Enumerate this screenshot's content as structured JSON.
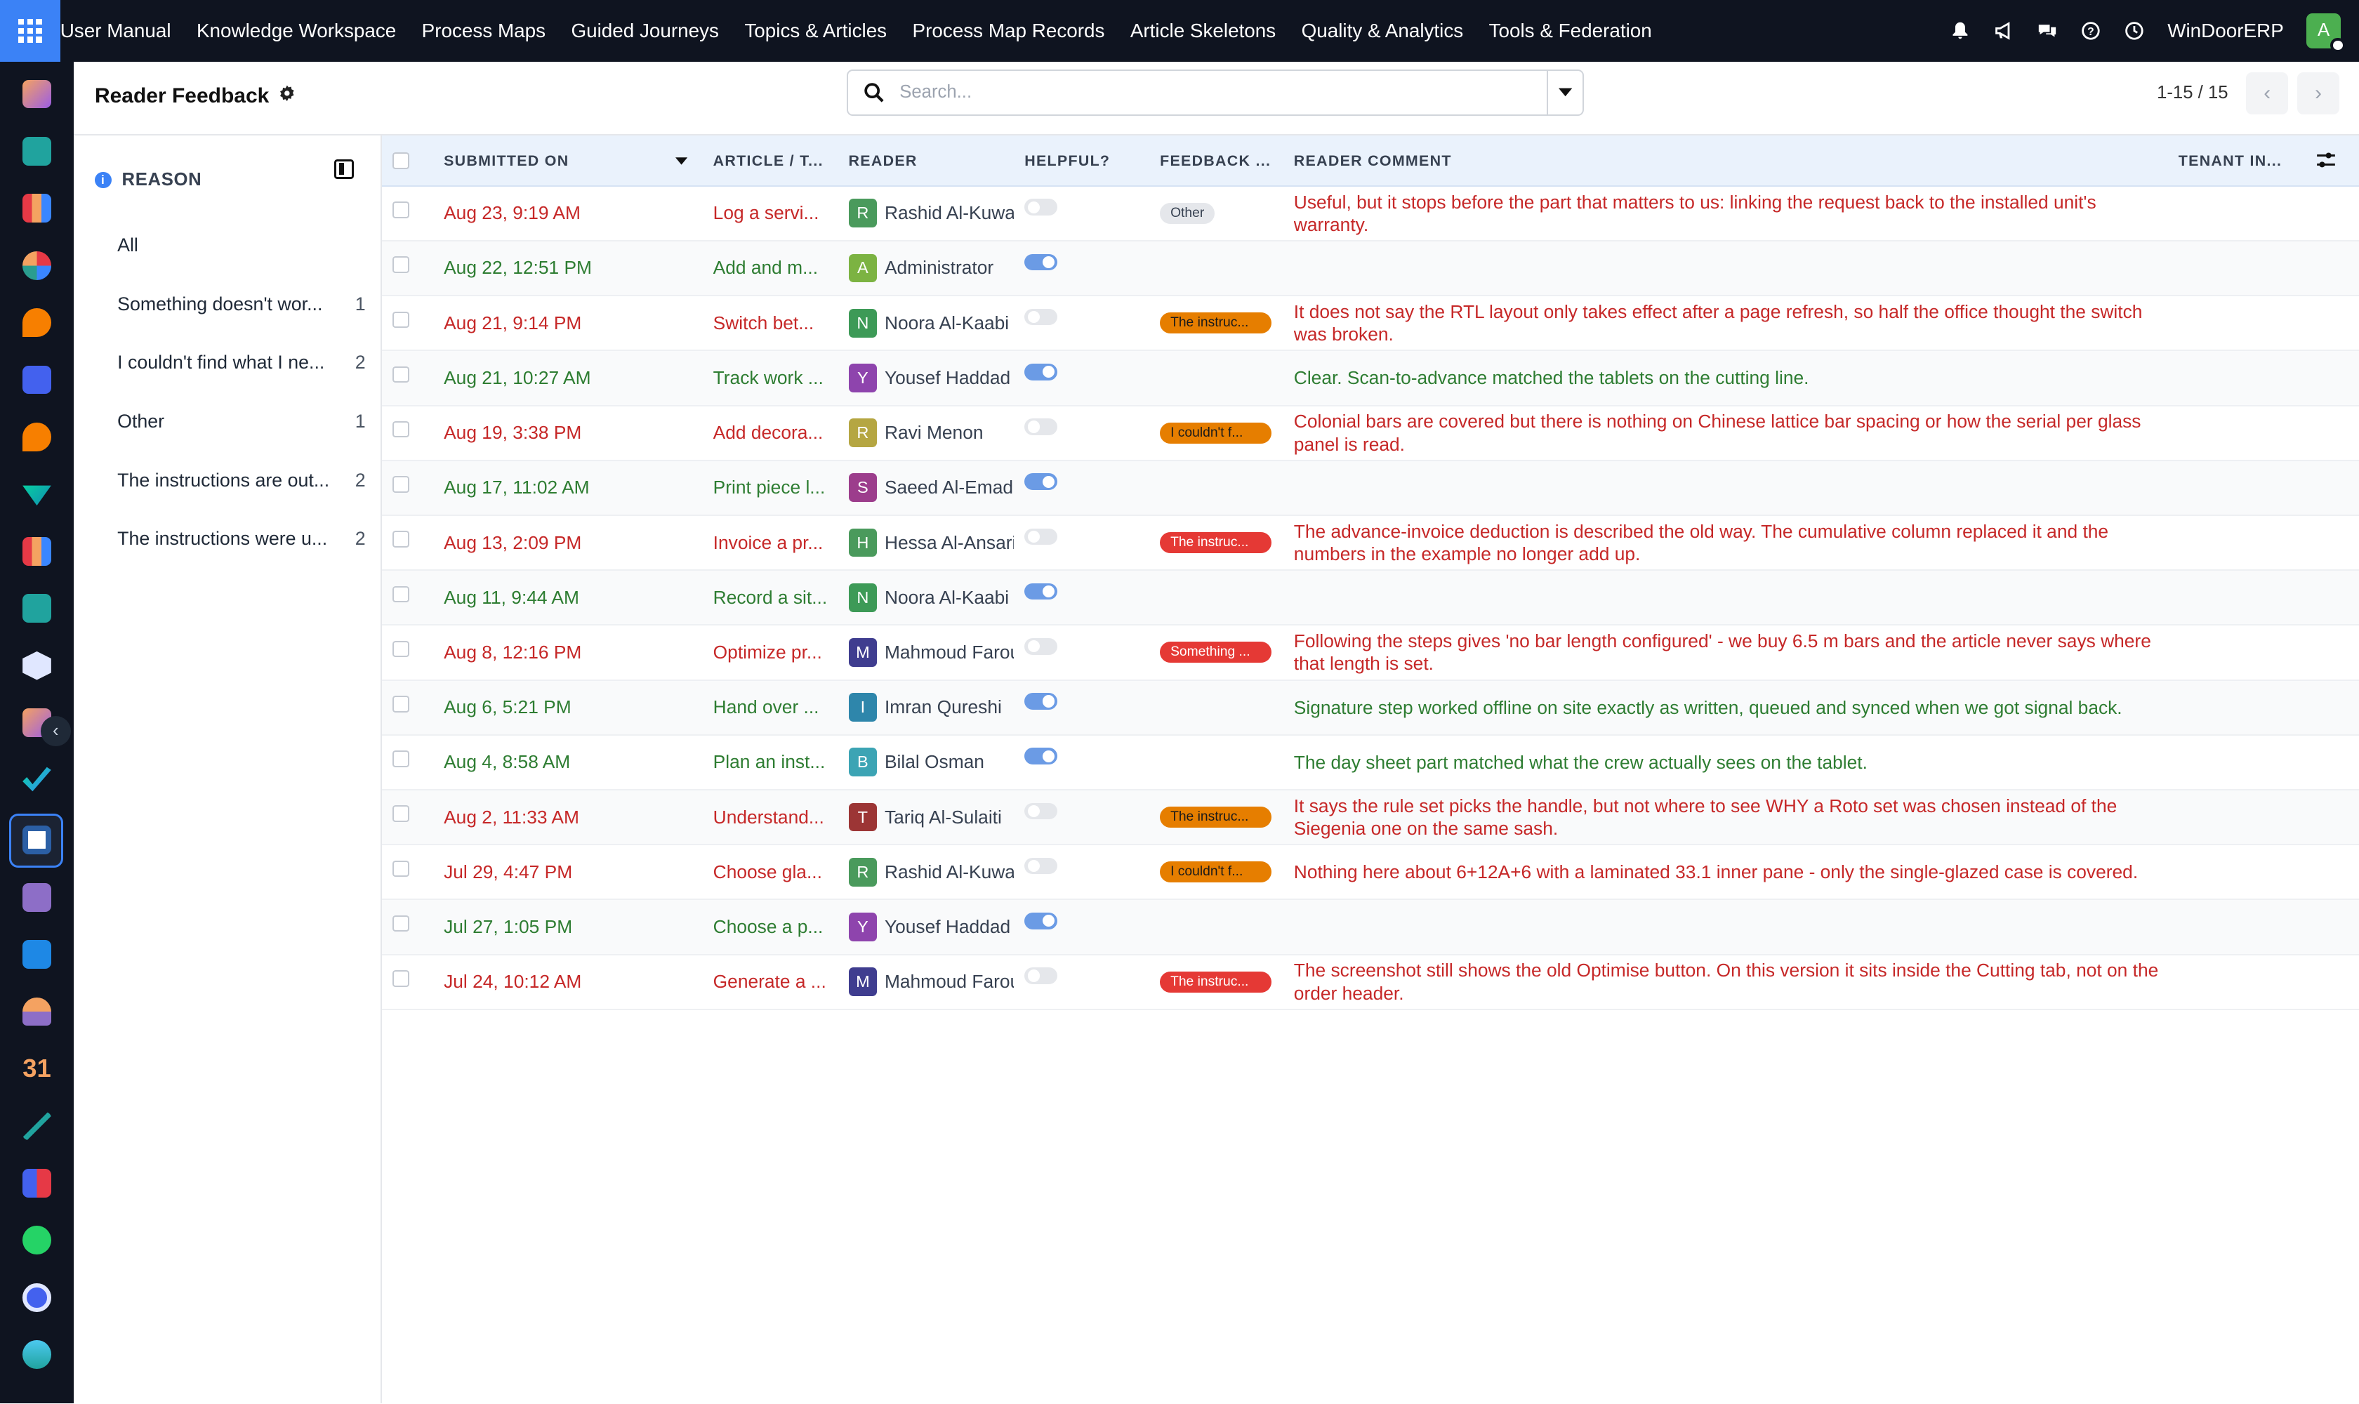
{
  "topbar": {
    "menu": [
      "User Manual",
      "Knowledge Workspace",
      "Process Maps",
      "Guided Journeys",
      "Topics & Articles",
      "Process Map Records",
      "Article Skeletons",
      "Quality & Analytics",
      "Tools & Federation"
    ],
    "company": "WinDoorERP",
    "user_initial": "A"
  },
  "control_panel": {
    "title": "Reader Feedback",
    "search_placeholder": "Search...",
    "pager": "1-15 / 15"
  },
  "side_panel": {
    "heading": "REASON",
    "categories": [
      {
        "label": "All",
        "count": ""
      },
      {
        "label": "Something doesn't wor...",
        "count": "1"
      },
      {
        "label": "I couldn't find what I ne...",
        "count": "2"
      },
      {
        "label": "Other",
        "count": "1"
      },
      {
        "label": "The instructions are out...",
        "count": "2"
      },
      {
        "label": "The instructions were u...",
        "count": "2"
      }
    ]
  },
  "columns": {
    "submitted": "SUBMITTED ON",
    "article": "ARTICLE / T...",
    "reader": "READER",
    "helpful": "HELPFUL?",
    "feedback": "FEEDBACK ...",
    "comment": "READER COMMENT",
    "tenant": "TENANT IN..."
  },
  "rows": [
    {
      "date": "Aug 23, 9:19 AM",
      "article": "Log a servi...",
      "reader": "Rashid Al-Kuwa",
      "initial": "R",
      "avatar_color": "#4a9a5c",
      "helpful": false,
      "reason": "Other",
      "reason_style": "gray",
      "comment": "Useful, but it stops before the part that matters to us: linking the request back to the installed unit's warranty."
    },
    {
      "date": "Aug 22, 12:51 PM",
      "article": "Add and m...",
      "reader": "Administrator",
      "initial": "A",
      "avatar_color": "#7cb342",
      "helpful": true,
      "reason": "",
      "reason_style": "",
      "comment": ""
    },
    {
      "date": "Aug 21, 9:14 PM",
      "article": "Switch bet...",
      "reader": "Noora Al-Kaabi",
      "initial": "N",
      "avatar_color": "#3d9a57",
      "helpful": false,
      "reason": "The instruc...",
      "reason_style": "orange",
      "comment": "It does not say the RTL layout only takes effect after a page refresh, so half the office thought the switch was broken."
    },
    {
      "date": "Aug 21, 10:27 AM",
      "article": "Track work ...",
      "reader": "Yousef Haddad",
      "initial": "Y",
      "avatar_color": "#8e44ad",
      "helpful": true,
      "reason": "",
      "reason_style": "",
      "comment": "Clear. Scan-to-advance matched the tablets on the cutting line."
    },
    {
      "date": "Aug 19, 3:38 PM",
      "article": "Add decora...",
      "reader": "Ravi Menon",
      "initial": "R",
      "avatar_color": "#b5a642",
      "helpful": false,
      "reason": "I couldn't f...",
      "reason_style": "orange",
      "comment": "Colonial bars are covered but there is nothing on Chinese lattice bar spacing or how the serial per glass panel is read."
    },
    {
      "date": "Aug 17, 11:02 AM",
      "article": "Print piece l...",
      "reader": "Saeed Al-Emad",
      "initial": "S",
      "avatar_color": "#9c3d8c",
      "helpful": true,
      "reason": "",
      "reason_style": "",
      "comment": ""
    },
    {
      "date": "Aug 13, 2:09 PM",
      "article": "Invoice a pr...",
      "reader": "Hessa Al-Ansari",
      "initial": "H",
      "avatar_color": "#4a9a5c",
      "helpful": false,
      "reason": "The instruc...",
      "reason_style": "redb",
      "comment": "The advance-invoice deduction is described the old way. The cumulative column replaced it and the numbers in the example no longer add up."
    },
    {
      "date": "Aug 11, 9:44 AM",
      "article": "Record a sit...",
      "reader": "Noora Al-Kaabi",
      "initial": "N",
      "avatar_color": "#3d9a57",
      "helpful": true,
      "reason": "",
      "reason_style": "",
      "comment": ""
    },
    {
      "date": "Aug 8, 12:16 PM",
      "article": "Optimize pr...",
      "reader": "Mahmoud Farouk",
      "initial": "M",
      "avatar_color": "#3f3d8f",
      "helpful": false,
      "reason": "Something ...",
      "reason_style": "redb",
      "comment": "Following the steps gives 'no bar length configured' - we buy 6.5 m bars and the article never says where that length is set."
    },
    {
      "date": "Aug 6, 5:21 PM",
      "article": "Hand over ...",
      "reader": "Imran Qureshi",
      "initial": "I",
      "avatar_color": "#2e86ab",
      "helpful": true,
      "reason": "",
      "reason_style": "",
      "comment": "Signature step worked offline on site exactly as written, queued and synced when we got signal back."
    },
    {
      "date": "Aug 4, 8:58 AM",
      "article": "Plan an inst...",
      "reader": "Bilal Osman",
      "initial": "B",
      "avatar_color": "#3ca4b4",
      "helpful": true,
      "reason": "",
      "reason_style": "",
      "comment": "The day sheet part matched what the crew actually sees on the tablet."
    },
    {
      "date": "Aug 2, 11:33 AM",
      "article": "Understand...",
      "reader": "Tariq Al-Sulaiti",
      "initial": "T",
      "avatar_color": "#9c3535",
      "helpful": false,
      "reason": "The instruc...",
      "reason_style": "orange",
      "comment": "It says the rule set picks the handle, but not where to see WHY a Roto set was chosen instead of the Siegenia one on the same sash."
    },
    {
      "date": "Jul 29, 4:47 PM",
      "article": "Choose gla...",
      "reader": "Rashid Al-Kuwa",
      "initial": "R",
      "avatar_color": "#4a9a5c",
      "helpful": false,
      "reason": "I couldn't f...",
      "reason_style": "orange",
      "comment": "Nothing here about 6+12A+6 with a laminated 33.1 inner pane - only the single-glazed case is covered."
    },
    {
      "date": "Jul 27, 1:05 PM",
      "article": "Choose a p...",
      "reader": "Yousef Haddad",
      "initial": "Y",
      "avatar_color": "#8e44ad",
      "helpful": true,
      "reason": "",
      "reason_style": "",
      "comment": ""
    },
    {
      "date": "Jul 24, 10:12 AM",
      "article": "Generate a ...",
      "reader": "Mahmoud Farouk",
      "initial": "M",
      "avatar_color": "#3f3d8f",
      "helpful": false,
      "reason": "The instruc...",
      "reason_style": "redb",
      "comment": "The screenshot still shows the old Optimise button. On this version it sits inside the Cutting tab, not on the order header."
    }
  ],
  "colors": {
    "topbar": "#0f1420",
    "accent": "#3b82f6",
    "header_bg": "#eaf2fc",
    "unhelpful_text": "#c62828",
    "helpful_text": "#2e7d32"
  }
}
